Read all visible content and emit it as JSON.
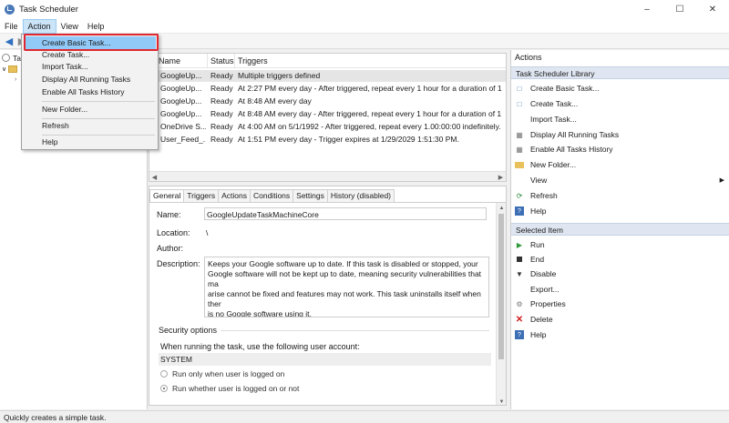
{
  "window": {
    "title": "Task Scheduler",
    "minimize": "–",
    "maximize": "☐",
    "close": "✕"
  },
  "menubar": [
    "File",
    "Action",
    "View",
    "Help"
  ],
  "tree": {
    "root_label": "Ta"
  },
  "task_list": {
    "columns": [
      "Name",
      "Status",
      "Triggers"
    ],
    "rows": [
      {
        "name": "GoogleUp...",
        "status": "Ready",
        "triggers": "Multiple triggers defined"
      },
      {
        "name": "GoogleUp...",
        "status": "Ready",
        "triggers": "At 2:27 PM every day - After triggered, repeat every 1 hour for a duration of 1"
      },
      {
        "name": "GoogleUp...",
        "status": "Ready",
        "triggers": "At 8:48 AM every day"
      },
      {
        "name": "GoogleUp...",
        "status": "Ready",
        "triggers": "At 8:48 AM every day - After triggered, repeat every 1 hour for a duration of 1"
      },
      {
        "name": "OneDrive S...",
        "status": "Ready",
        "triggers": "At 4:00 AM on 5/1/1992 - After triggered, repeat every 1.00:00:00 indefinitely."
      },
      {
        "name": "User_Feed_...",
        "status": "Ready",
        "triggers": "At 1:51 PM every day - Trigger expires at 1/29/2029 1:51:30 PM."
      }
    ]
  },
  "props": {
    "tabs": [
      "General",
      "Triggers",
      "Actions",
      "Conditions",
      "Settings",
      "History (disabled)"
    ],
    "name_label": "Name:",
    "name_value": "GoogleUpdateTaskMachineCore",
    "location_label": "Location:",
    "location_value": "\\",
    "author_label": "Author:",
    "description_label": "Description:",
    "description_value": "Keeps your Google software up to date. If this task is disabled or stopped, your\nGoogle software will not be kept up to date, meaning security vulnerabilities that ma\narise cannot be fixed and features may not work. This task uninstalls itself when ther\nis no Google software using it.",
    "security_options": "Security options",
    "run_account_label": "When running the task, use the following user account:",
    "run_account_value": "SYSTEM",
    "radio_logged_on": "Run only when user is logged on",
    "radio_whether": "Run whether user is logged on or not"
  },
  "actions_pane": {
    "title": "Actions",
    "library_section": "Task Scheduler Library",
    "library_items": [
      "Create Basic Task...",
      "Create Task...",
      "Import Task...",
      "Display All Running Tasks",
      "Enable All Tasks History",
      "New Folder...",
      "View",
      "Refresh",
      "Help"
    ],
    "selected_section": "Selected Item",
    "selected_items": [
      "Run",
      "End",
      "Disable",
      "Export...",
      "Properties",
      "Delete",
      "Help"
    ]
  },
  "dropdown": {
    "items": [
      "Create Basic Task...",
      "Create Task...",
      "Import Task...",
      "Display All Running Tasks",
      "Enable All Tasks History",
      "New Folder...",
      "Refresh",
      "Help"
    ]
  },
  "statusbar": "Quickly creates a simple task.",
  "colors": {
    "highlight": "#91c9f7",
    "callout": "#e0262f",
    "section_bg": "#dfe6f1"
  }
}
